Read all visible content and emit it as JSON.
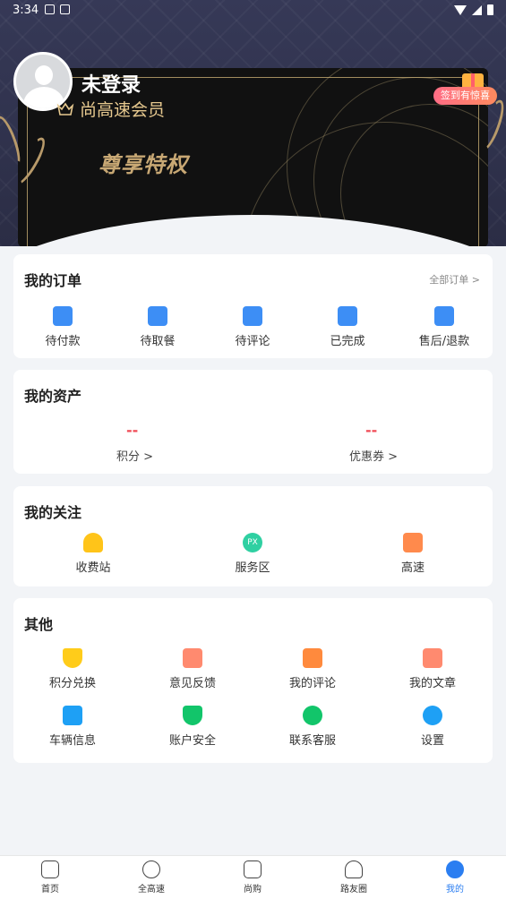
{
  "status_bar": {
    "time": "3:34"
  },
  "profile": {
    "name": "未登录",
    "member_label": "尚高速会员",
    "privilege_label": "尊享特权",
    "signin_badge": "签到有惊喜"
  },
  "orders": {
    "title": "我的订单",
    "all_link": "全部订单 >",
    "items": [
      {
        "label": "待付款",
        "icon": "wallet-icon"
      },
      {
        "label": "待取餐",
        "icon": "meal-icon"
      },
      {
        "label": "待评论",
        "icon": "comment-doc-icon"
      },
      {
        "label": "已完成",
        "icon": "completed-doc-icon"
      },
      {
        "label": "售后/退款",
        "icon": "refund-icon"
      }
    ]
  },
  "assets": {
    "title": "我的资产",
    "items": [
      {
        "value": "--",
        "label": "积分 >"
      },
      {
        "value": "--",
        "label": "优惠券 >"
      }
    ]
  },
  "follow": {
    "title": "我的关注",
    "items": [
      {
        "label": "收费站",
        "icon": "toll-station-icon"
      },
      {
        "label": "服务区",
        "icon": "service-area-icon",
        "badge": "PX"
      },
      {
        "label": "高速",
        "icon": "highway-icon"
      }
    ]
  },
  "other": {
    "title": "其他",
    "items": [
      {
        "label": "积分兑换",
        "icon": "points-exchange-icon"
      },
      {
        "label": "意见反馈",
        "icon": "feedback-icon"
      },
      {
        "label": "我的评论",
        "icon": "my-comments-icon"
      },
      {
        "label": "我的文章",
        "icon": "my-articles-icon"
      },
      {
        "label": "车辆信息",
        "icon": "vehicle-icon"
      },
      {
        "label": "账户安全",
        "icon": "security-shield-icon"
      },
      {
        "label": "联系客服",
        "icon": "customer-service-icon"
      },
      {
        "label": "设置",
        "icon": "settings-icon"
      }
    ]
  },
  "bottom_nav": {
    "items": [
      {
        "label": "首页",
        "icon": "home-icon"
      },
      {
        "label": "全高速",
        "icon": "highway-nav-icon"
      },
      {
        "label": "尚购",
        "icon": "shop-icon"
      },
      {
        "label": "路友圈",
        "icon": "community-icon"
      },
      {
        "label": "我的",
        "icon": "profile-icon",
        "active": true
      }
    ]
  },
  "colors": {
    "accent": "#2b7ef1",
    "price_red": "#f04c57",
    "gold": "#c8a874"
  }
}
